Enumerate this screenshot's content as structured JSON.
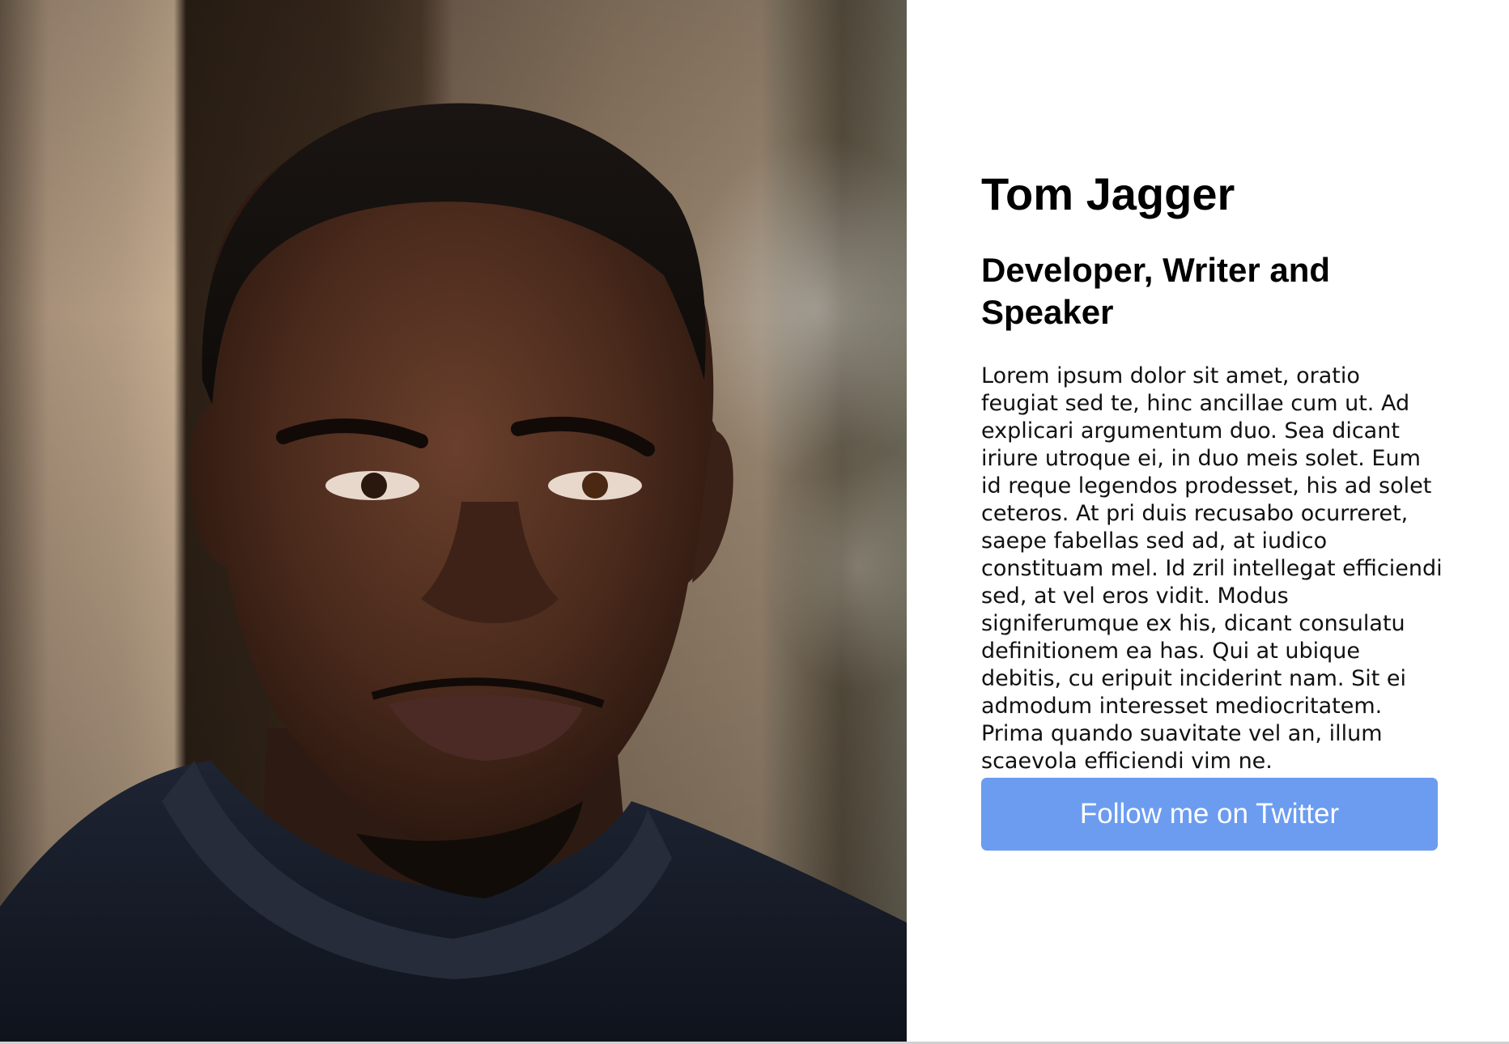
{
  "profile": {
    "name": "Tom Jagger",
    "tagline": "Developer, Writer and Speaker",
    "bio": "Lorem ipsum dolor sit amet, oratio feugiat sed te, hinc ancillae cum ut. Ad explicari argumentum duo. Sea dicant iriure utroque ei, in duo meis solet. Eum id reque legendos prodesset, his ad solet ceteros. At pri duis recusabo ocurreret, saepe fabellas sed ad, at iudico constituam mel. Id zril intellegat efficiendi sed, at vel eros vidit. Modus signiferumque ex his, dicant consulatu definitionem ea has. Qui at ubique debitis, cu eripuit inciderint nam. Sit ei admodum interesset mediocritatem. Prima quando suavitate vel an, illum scaevola efficiendi vim ne.",
    "cta_label": "Follow me on Twitter"
  },
  "colors": {
    "button": "#6b9cf0",
    "button_text": "#ffffff",
    "background": "#ffffff",
    "heading": "#000000"
  }
}
